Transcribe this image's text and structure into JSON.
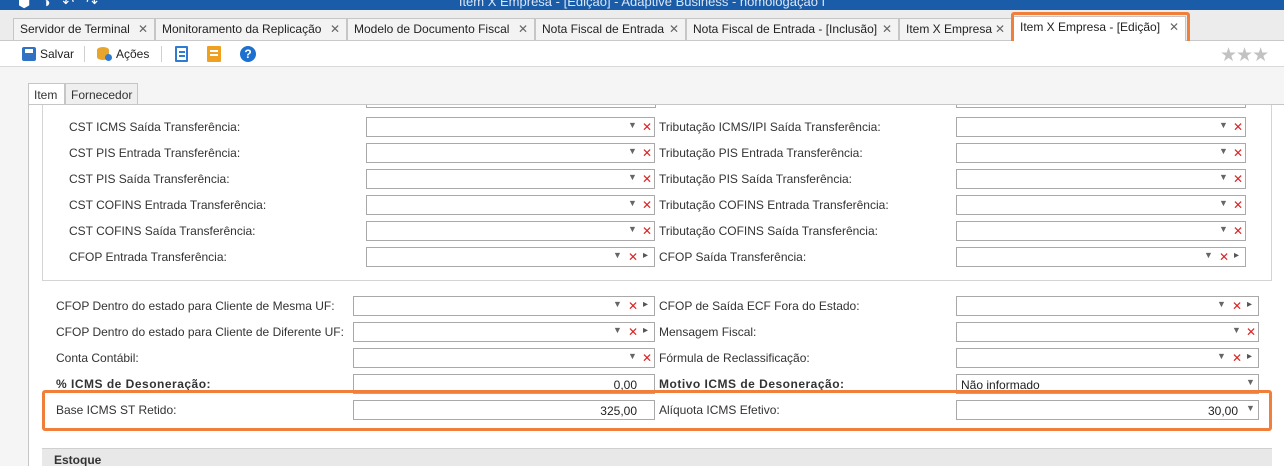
{
  "window": {
    "title": "Item X Empresa - [Edição] - Adaptive Business - homologação I",
    "quick_icons": "⬢ ◑ ↶ ↷"
  },
  "doc_tabs": [
    {
      "label": "Servidor de Terminal",
      "close": "✕"
    },
    {
      "label": "Monitoramento da Replicação",
      "close": "✕"
    },
    {
      "label": "Modelo de Documento Fiscal",
      "close": "✕"
    },
    {
      "label": "Nota Fiscal de Entrada",
      "close": "✕"
    },
    {
      "label": "Nota Fiscal de Entrada - [Inclusão]",
      "close": "✕"
    },
    {
      "label": "Item X Empresa",
      "close": "✕"
    },
    {
      "label": "Item X Empresa - [Edição]",
      "close": "✕"
    }
  ],
  "toolbar": {
    "save_label": "Salvar",
    "actions_label": "Ações",
    "help_glyph": "?",
    "rating_stars": "★★★"
  },
  "inner_tabs": [
    {
      "label": "Item"
    },
    {
      "label": "Fornecedor"
    }
  ],
  "glyphs": {
    "dropdown": "▼",
    "clear": "✕",
    "next": "▸"
  },
  "transfer_left": [
    {
      "label": "CST ICMS Saída Transferência:",
      "value": ""
    },
    {
      "label": "CST PIS Entrada Transferência:",
      "value": ""
    },
    {
      "label": "CST PIS Saída Transferência:",
      "value": ""
    },
    {
      "label": "CST COFINS Entrada Transferência:",
      "value": ""
    },
    {
      "label": "CST COFINS Saída Transferência:",
      "value": ""
    },
    {
      "label": "CFOP Entrada Transferência:",
      "value": ""
    }
  ],
  "transfer_right": [
    {
      "label": "Tributação ICMS/IPI Saída Transferência:",
      "value": ""
    },
    {
      "label": "Tributação PIS Entrada Transferência:",
      "value": ""
    },
    {
      "label": "Tributação PIS Saída Transferência:",
      "value": ""
    },
    {
      "label": "Tributação COFINS Entrada Transferência:",
      "value": ""
    },
    {
      "label": "Tributação COFINS Saída Transferência:",
      "value": ""
    },
    {
      "label": "CFOP Saída Transferência:",
      "value": ""
    }
  ],
  "main_left": [
    {
      "label": "CFOP Dentro do estado para Cliente de Mesma UF:",
      "value": ""
    },
    {
      "label": "CFOP Dentro do estado para Cliente de Diferente UF:",
      "value": ""
    },
    {
      "label": "Conta Contábil:",
      "value": ""
    },
    {
      "label": "% ICMS de Desoneração:",
      "value": "0,00"
    },
    {
      "label": "Base ICMS ST Retido:",
      "value": "325,00"
    }
  ],
  "main_right": [
    {
      "label": "CFOP de Saída ECF Fora do Estado:",
      "value": ""
    },
    {
      "label": "Mensagem Fiscal:",
      "value": ""
    },
    {
      "label": "Fórmula de Reclassificação:",
      "value": ""
    },
    {
      "label": "Motivo ICMS de Desoneração:",
      "value": "Não informado"
    },
    {
      "label": "Alíquota ICMS Efetivo:",
      "value": "30,00"
    }
  ],
  "section_estoque": "Estoque",
  "colors": {
    "highlight": "#f07f3c",
    "titlebar": "#1a5ca8",
    "clear": "#dd2222"
  }
}
